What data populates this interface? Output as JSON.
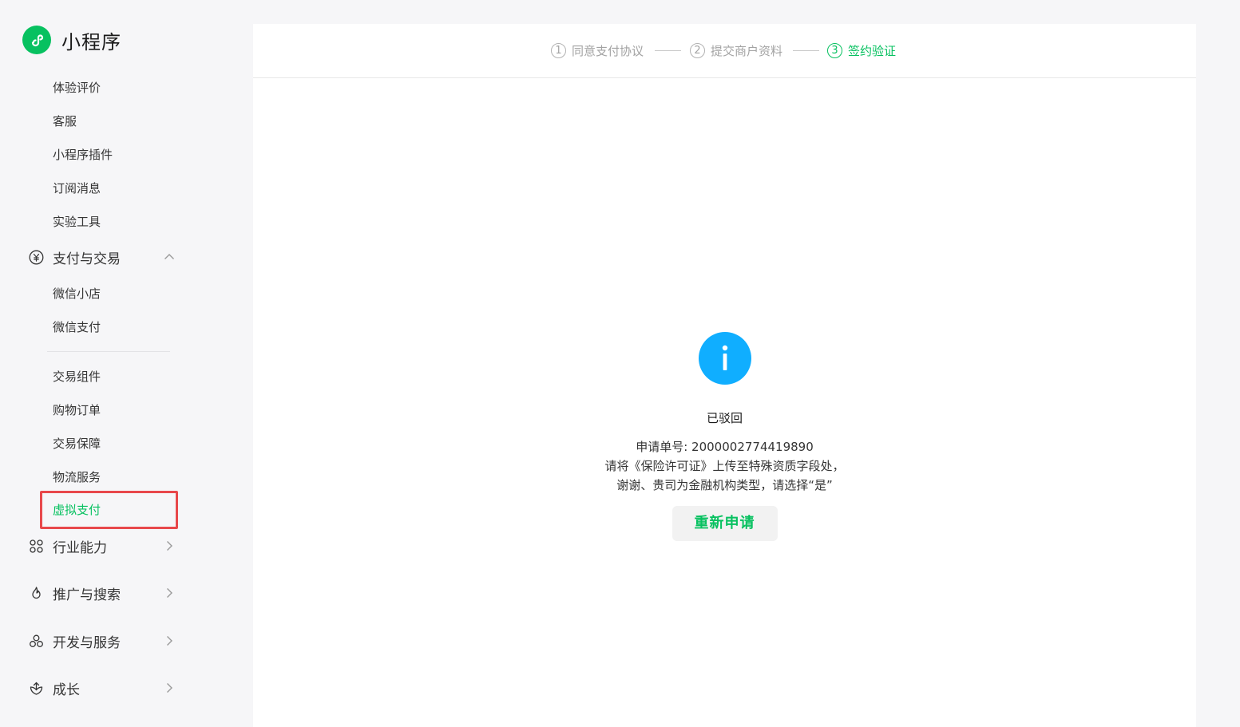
{
  "brand": {
    "name": "小程序"
  },
  "sidebar": {
    "top_items": [
      {
        "label": "体验评价"
      },
      {
        "label": "客服"
      },
      {
        "label": "小程序插件"
      },
      {
        "label": "订阅消息"
      },
      {
        "label": "实验工具"
      }
    ],
    "pay_group": {
      "label": "支付与交易",
      "icon": "yen-icon",
      "expanded": true,
      "items_a": [
        {
          "label": "微信小店"
        },
        {
          "label": "微信支付"
        }
      ],
      "items_b": [
        {
          "label": "交易组件"
        },
        {
          "label": "购物订单"
        },
        {
          "label": "交易保障"
        },
        {
          "label": "物流服务"
        },
        {
          "label": "虚拟支付",
          "active": true
        }
      ]
    },
    "groups": [
      {
        "label": "行业能力",
        "icon": "industry-icon"
      },
      {
        "label": "推广与搜索",
        "icon": "flame-icon"
      },
      {
        "label": "开发与服务",
        "icon": "cubes-icon"
      },
      {
        "label": "成长",
        "icon": "growth-icon"
      }
    ]
  },
  "steps": [
    {
      "num": "1",
      "label": "同意支付协议",
      "state": "done"
    },
    {
      "num": "2",
      "label": "提交商户资料",
      "state": "done"
    },
    {
      "num": "3",
      "label": "签约验证",
      "state": "current"
    }
  ],
  "result": {
    "status": "已驳回",
    "application_line": "申请单号: 2000002774419890",
    "reason_line1": "请将《保险许可证》上传至特殊资质字段处，",
    "reason_line2": "谢谢、贵司为金融机构类型，请选择“是”",
    "button_label": "重新申请"
  },
  "colors": {
    "brand_green": "#07c160",
    "info_blue": "#10aeff",
    "highlight_red": "#e8484b"
  }
}
